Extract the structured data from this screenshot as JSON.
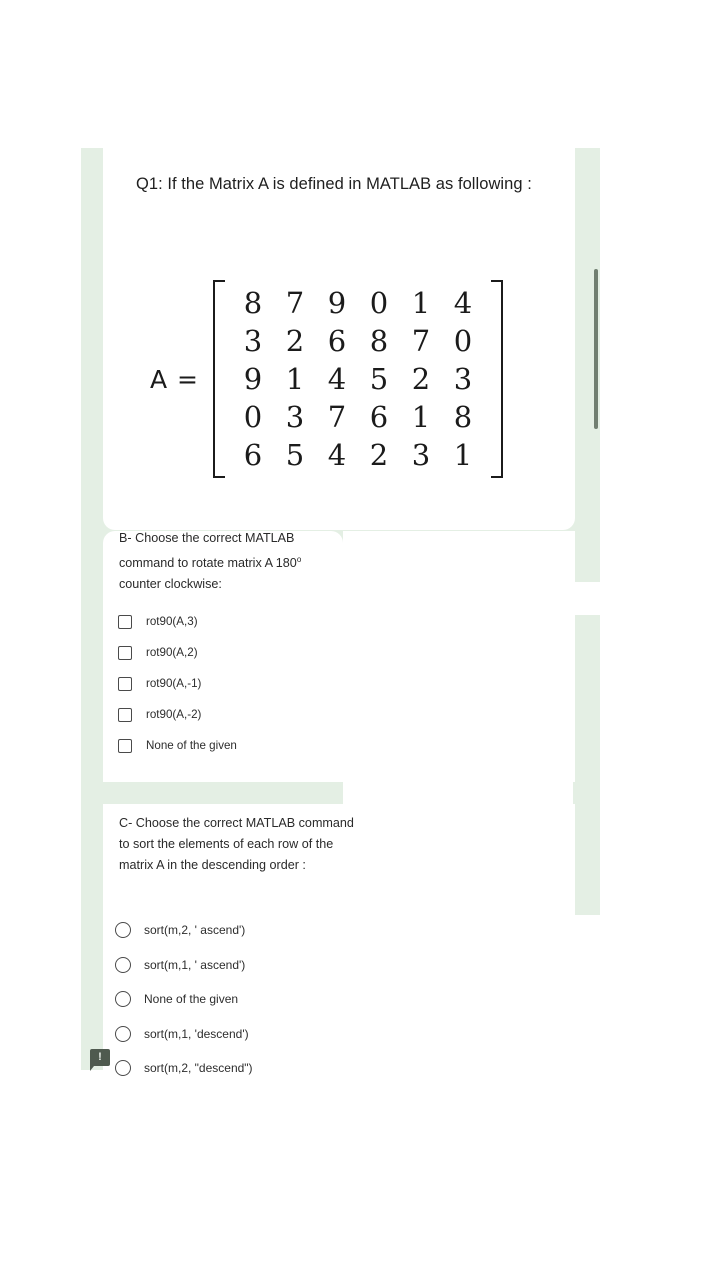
{
  "theme": {
    "page_background": "#ffffff",
    "panel_green": "#e4efe4",
    "card_white": "#ffffff",
    "text_primary": "#1f1f1f",
    "text_secondary": "#2d2d2d",
    "control_outline": "#4a4a4a",
    "scrollbar_thumb": "#5d6b5d",
    "report_icon_fill": "#4f5a4f"
  },
  "question": {
    "title": "Q1: If the Matrix A is defined in MATLAB as following :",
    "matrix_label": "A  =",
    "matrix_rows": [
      [
        "8",
        "7",
        "9",
        "0",
        "1",
        "4"
      ],
      [
        "3",
        "2",
        "6",
        "8",
        "7",
        "0"
      ],
      [
        "9",
        "1",
        "4",
        "5",
        "2",
        "3"
      ],
      [
        "0",
        "3",
        "7",
        "6",
        "1",
        "8"
      ],
      [
        "6",
        "5",
        "4",
        "2",
        "3",
        "1"
      ]
    ]
  },
  "part_b": {
    "prompt_line1": "B- Choose the correct MATLAB",
    "prompt_line2": "command to rotate matrix A 180",
    "prompt_degree": "o",
    "prompt_line3": "counter clockwise:",
    "input_type": "checkbox",
    "options": [
      {
        "label": "rot90(A,3)",
        "checked": false
      },
      {
        "label": "rot90(A,2)",
        "checked": false
      },
      {
        "label": "rot90(A,-1)",
        "checked": false
      },
      {
        "label": "rot90(A,-2)",
        "checked": false
      },
      {
        "label": "None of the given",
        "checked": false
      }
    ]
  },
  "part_c": {
    "prompt": "C- Choose the correct MATLAB command to sort the elements of each row of the matrix A in the descending order :",
    "input_type": "radio",
    "options": [
      {
        "label": "sort(m,2, ' ascend')",
        "checked": false
      },
      {
        "label": "sort(m,1, ' ascend')",
        "checked": false
      },
      {
        "label": "None of the given",
        "checked": false
      },
      {
        "label": "sort(m,1, 'descend')",
        "checked": false
      },
      {
        "label": "sort(m,2, \"descend\")",
        "checked": false
      }
    ]
  },
  "report_icon": {
    "glyph": "!",
    "name": "report-flag-icon"
  }
}
